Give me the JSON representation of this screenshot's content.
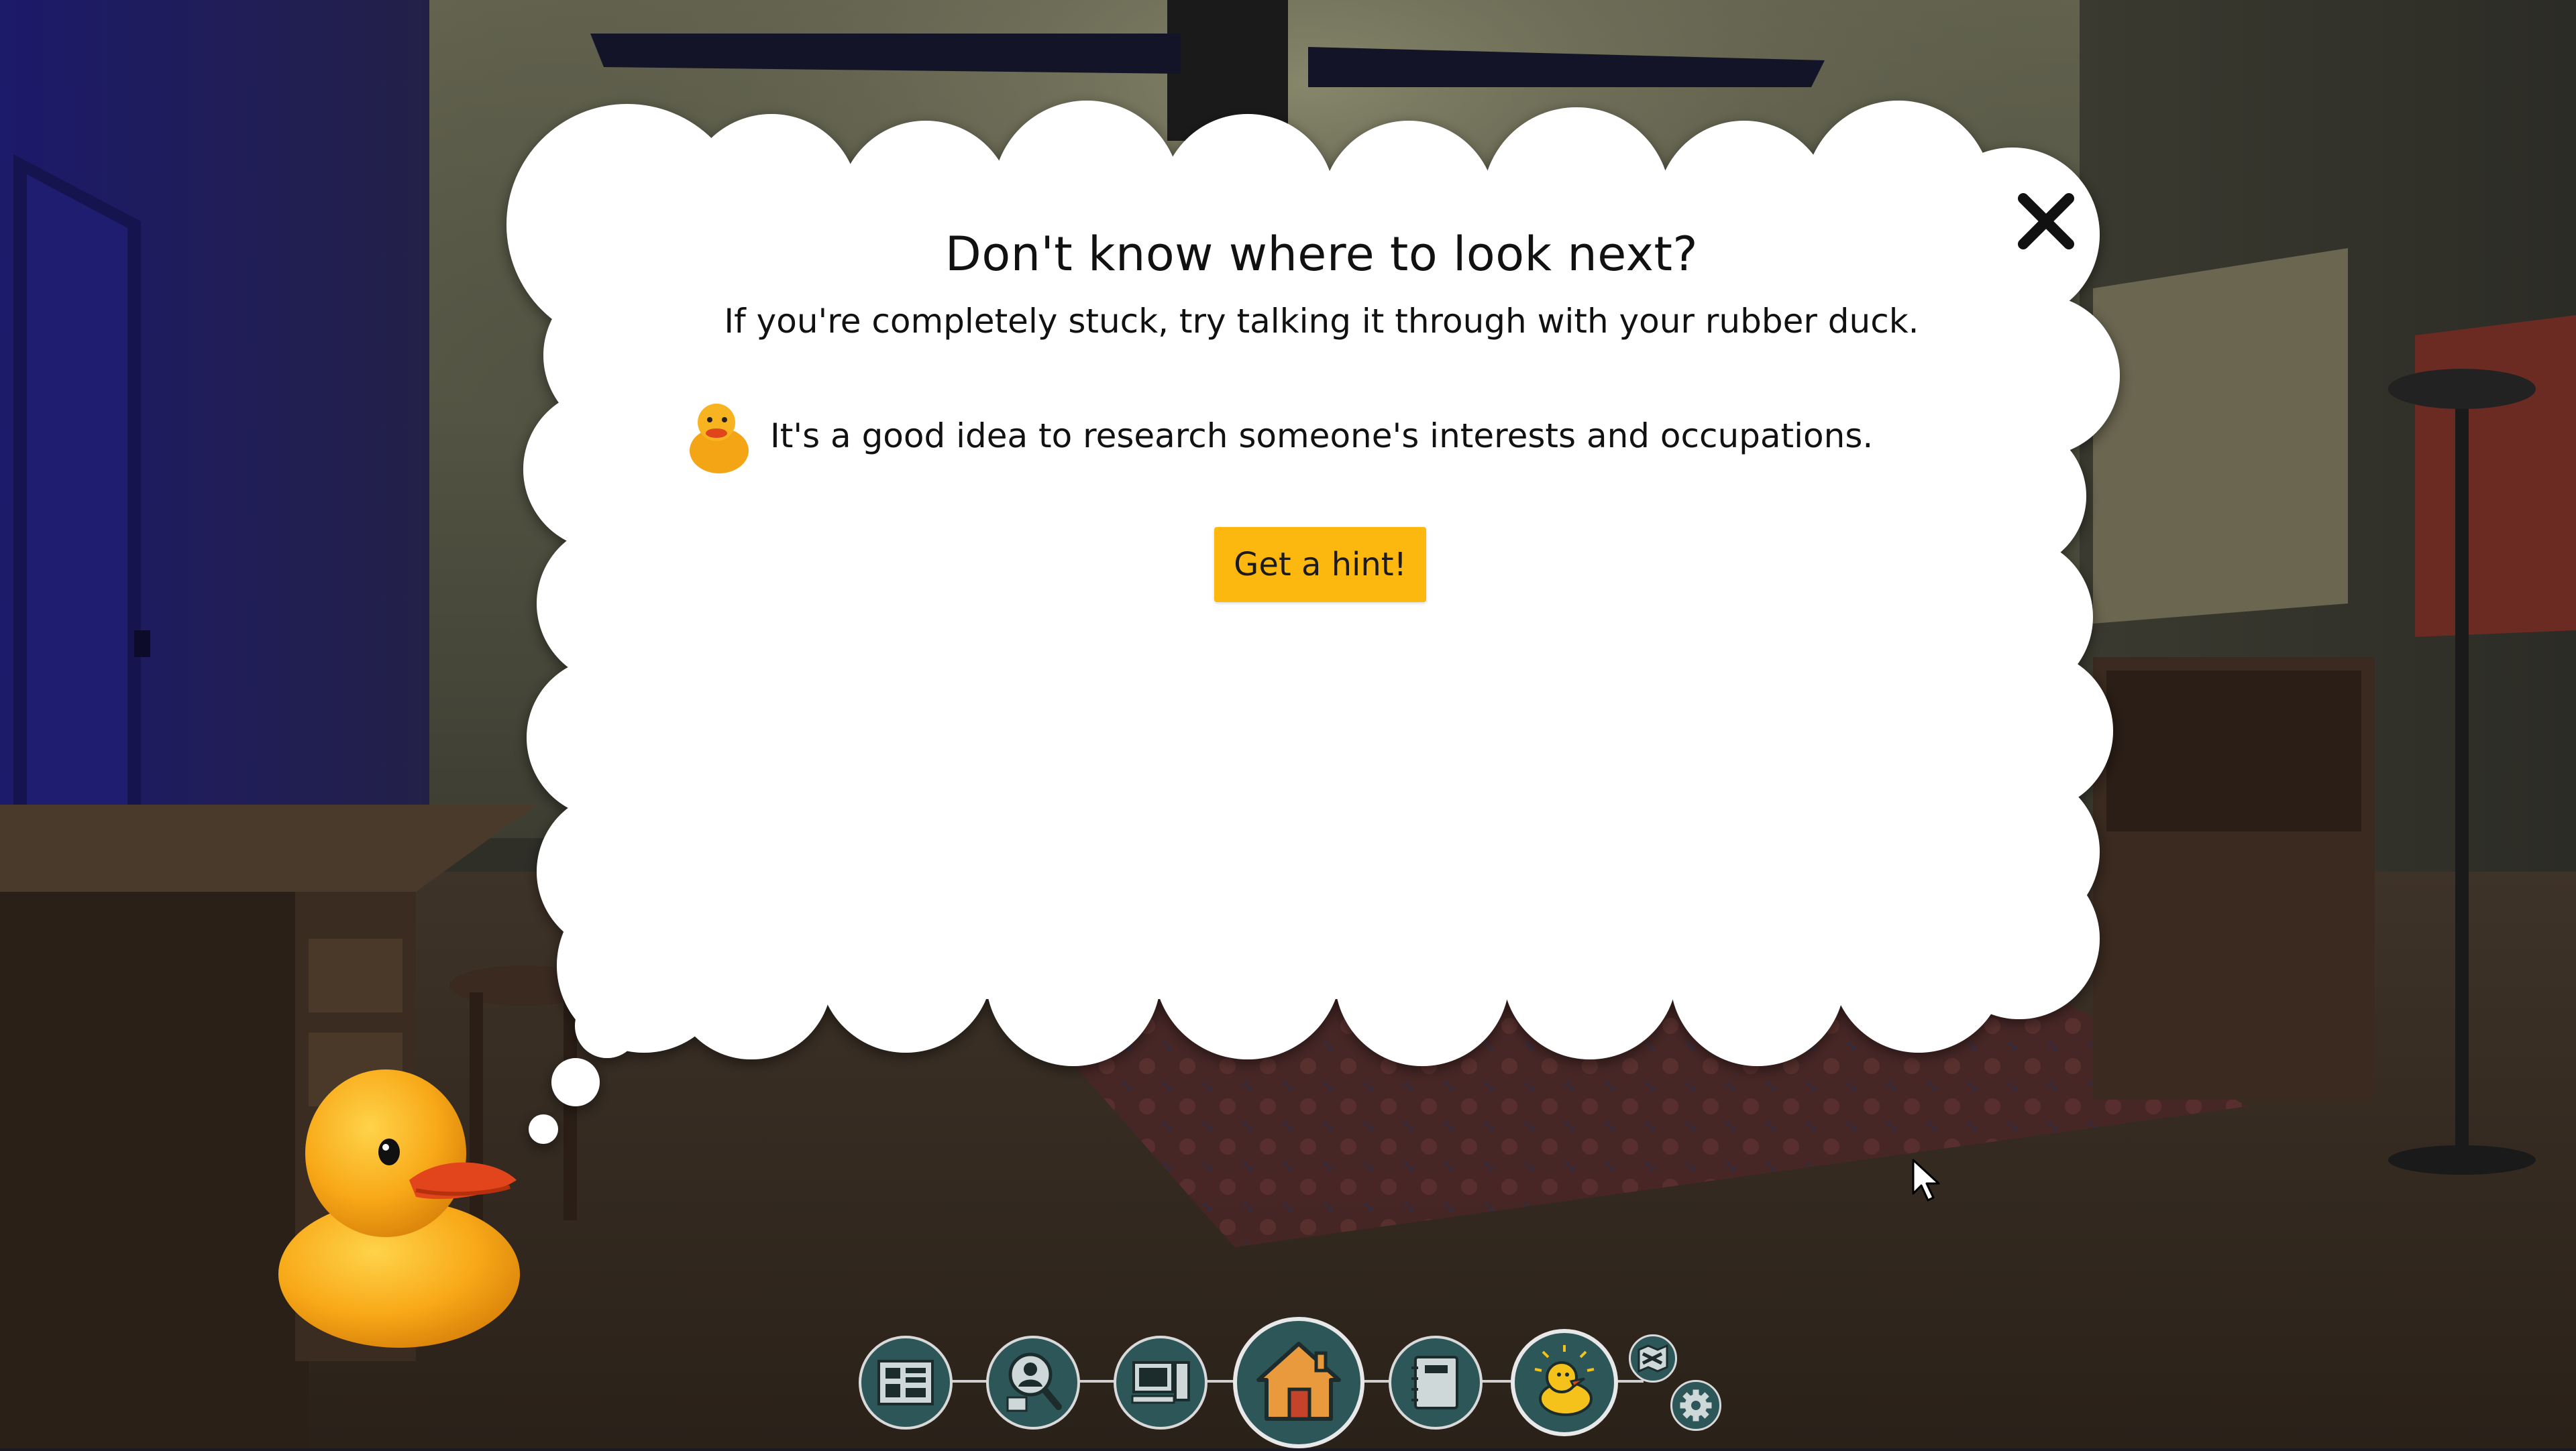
{
  "dialog": {
    "title": "Don't know where to look next?",
    "subtitle": "If you're completely stuck, try talking it through with your rubber duck.",
    "hint_text": "It's a good idea to research someone's interests and occupations.",
    "hint_icon": "rubber-duck-icon",
    "get_hint_label": "Get a hint!",
    "close_icon": "close-icon"
  },
  "toolbar": {
    "items": [
      {
        "name": "case-board",
        "icon": "corkboard-icon"
      },
      {
        "name": "suspect-search",
        "icon": "person-magnifier-icon"
      },
      {
        "name": "computer",
        "icon": "computer-icon"
      },
      {
        "name": "home",
        "icon": "house-icon",
        "active": true
      },
      {
        "name": "notebook",
        "icon": "notebook-icon"
      },
      {
        "name": "rubber-duck",
        "icon": "duck-icon",
        "active": true
      },
      {
        "name": "map",
        "icon": "map-icon"
      },
      {
        "name": "settings",
        "icon": "gear-icon"
      }
    ]
  },
  "colors": {
    "accent_yellow": "#fdb80f",
    "toolbar_teal": "#2d5658",
    "toolbar_ring": "#e8e8e8",
    "home_orange": "#e89a3c"
  }
}
